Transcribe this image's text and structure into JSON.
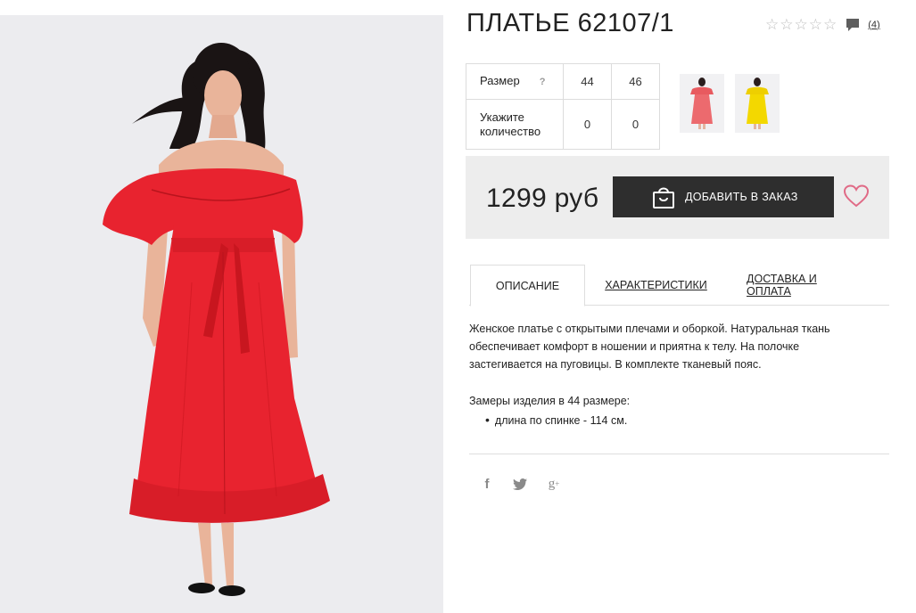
{
  "product": {
    "title": "ПЛАТЬЕ 62107/1",
    "review_count": "(4)",
    "rating_stars": 0,
    "price": "1299 руб",
    "add_to_cart_label": "ДОБАВИТЬ В ЗАКАЗ"
  },
  "size_table": {
    "size_label": "Размер",
    "help_mark": "?",
    "sizes": [
      "44",
      "46"
    ],
    "quantity_label_line1": "Укажите",
    "quantity_label_line2": "количество",
    "quantities": [
      "0",
      "0"
    ]
  },
  "tabs": [
    {
      "label": "ОПИСАНИЕ"
    },
    {
      "label": "ХАРАКТЕРИСТИКИ"
    },
    {
      "label": "ДОСТАВКА И ОПЛАТА"
    }
  ],
  "description": {
    "text": "Женское платье с открытыми плечами и оборкой. Натуральная ткань обеспечивает комфорт в ношении и приятна к телу. На полочке застегивается на пуговицы. В комплекте тканевый пояс.",
    "measurements_title": "Замеры изделия в 44 размере:",
    "measurements": [
      "длина по спинке - 114 см."
    ]
  },
  "colors": {
    "dress_red": "#e8232f",
    "dress_yellow": "#f3d800",
    "button_dark": "#2e2e2e",
    "heart_pink": "#e06a86",
    "buybox_bg": "#ededed"
  }
}
